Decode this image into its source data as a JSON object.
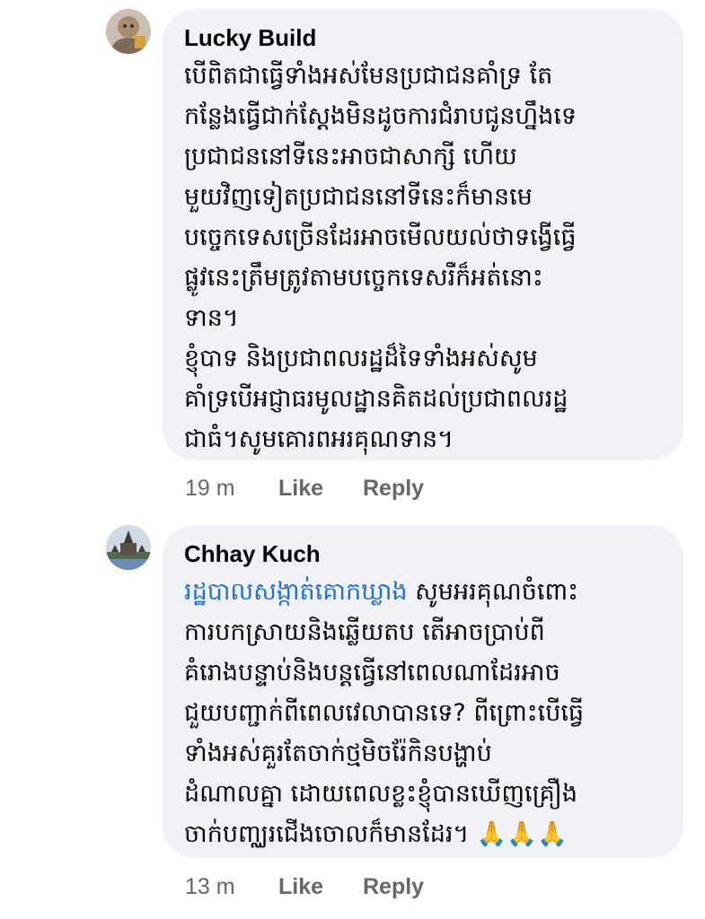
{
  "comments": [
    {
      "author": "Lucky Build",
      "text": "បើពិតជាធ្វើទាំងអស់មែនប្រជាជនគាំទ្រ តែ\nកន្លែងធ្វើជាក់ស្តែងមិនដូចការជំរាបជូនហ្នឹងទេ\nប្រជាជននៅទីនេះអាចជាសាក្សី ហើយ\nមួយវិញទៀតប្រជាជននៅទីនេះក៏មានមេ\nបច្ចេកទេសច្រើនដែរអាចមើលយល់ថាទង្វើធ្វើ\nផ្លូវនេះត្រឹមត្រូវតាមបច្ចេកទេសរឺក៏អត់នោះ\nទាន។\nខ្ញុំបាទ និងប្រជាពលរដ្ឋដ៏ទៃទាំងអស់សូម\nគាំទ្របើអជ្ញាធរមូលដ្ឋានគិតដល់ប្រជាពលរដ្ឋ\nជាធំ។សូមគោរពអរគុណទាន។",
      "time": "19 m",
      "like": "Like",
      "reply": "Reply"
    },
    {
      "author": "Chhay Kuch",
      "mention": "រដ្ឋបាលសង្កាត់គោកឃ្លាង",
      "text": " សូមអរគុណចំពោះ\nការបកស្រាយនិងឆ្លើយតប តើអាចប្រាប់ពី\nគំរោងបន្ទាប់និងបន្តធ្វើនៅពេលណាដែរអាច\nជួយបញ្ជាក់ពីពេលវេលាបានទេ? ពីព្រោះបើធ្វើ\nទាំងអស់គួរតែចាក់ថ្មមិចរ៉ែកិនបង្ហាប់\nដំណាលគ្នា ដោយពេលខ្លះខ្ញុំបានឃើញគ្រឿង\nចាក់បញ្ឈរជើងចោលក៏មានដែរ។ ",
      "emoji": "🙏🙏🙏",
      "time": "13 m",
      "like": "Like",
      "reply": "Reply"
    }
  ]
}
